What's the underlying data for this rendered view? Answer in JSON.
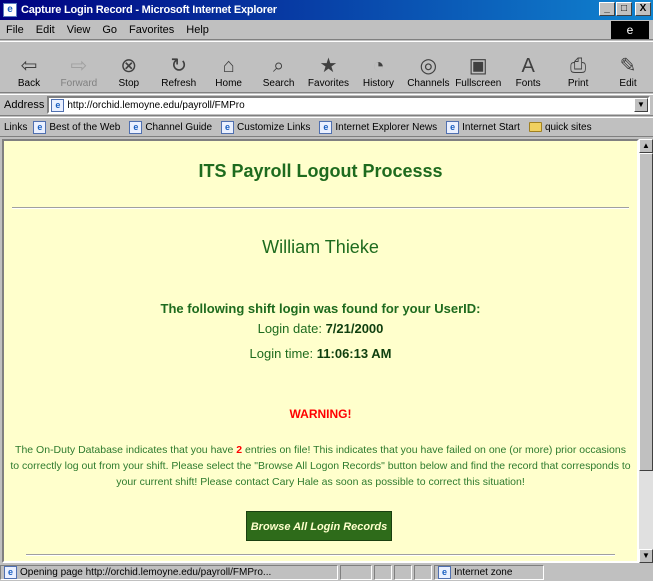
{
  "window": {
    "title": "Capture Login Record - Microsoft Internet Explorer",
    "min": "_",
    "max": "□",
    "close": "X"
  },
  "menu": [
    "File",
    "Edit",
    "View",
    "Go",
    "Favorites",
    "Help"
  ],
  "toolbar": [
    {
      "label": "Back",
      "icon": "⇦"
    },
    {
      "label": "Forward",
      "icon": "⇨"
    },
    {
      "label": "Stop",
      "icon": "⊗"
    },
    {
      "label": "Refresh",
      "icon": "↻"
    },
    {
      "label": "Home",
      "icon": "⌂"
    },
    {
      "label": "Search",
      "icon": "⌕"
    },
    {
      "label": "Favorites",
      "icon": "★"
    },
    {
      "label": "History",
      "icon": "◔"
    },
    {
      "label": "Channels",
      "icon": "◎"
    },
    {
      "label": "Fullscreen",
      "icon": "▣"
    },
    {
      "label": "Fonts",
      "icon": "A"
    },
    {
      "label": "Print",
      "icon": "⎙"
    },
    {
      "label": "Edit",
      "icon": "✎"
    }
  ],
  "address": {
    "label": "Address",
    "url": "http://orchid.lemoyne.edu/payroll/FMPro"
  },
  "links": {
    "label": "Links",
    "items": [
      "Best of the Web",
      "Channel Guide",
      "Customize Links",
      "Internet Explorer News",
      "Internet Start",
      "quick sites"
    ]
  },
  "page": {
    "heading": "ITS Payroll Logout Processs",
    "user_name": "William Thieke",
    "found_message": "The following shift login was found for your UserID:",
    "login_date_label": "Login date:",
    "login_date": "7/21/2000",
    "login_time_label": "Login time:",
    "login_time": "11:06:13 AM",
    "warning": "WARNING!",
    "warning_pre": "The On-Duty Database indicates that you have ",
    "warning_count": "2",
    "warning_post": " entries on file! This indicates that you have failed on one (or more) prior occasions to correctly log out from your shift. Please select the \"Browse All Logon Records\" button below and find the record that corresponds to your current shift! Please contact Cary Hale as soon as possible to correct this situation!",
    "browse_button": "Browse All Login Records"
  },
  "status": {
    "text": "Opening page http://orchid.lemoyne.edu/payroll/FMPro...",
    "zone": "Internet zone"
  }
}
